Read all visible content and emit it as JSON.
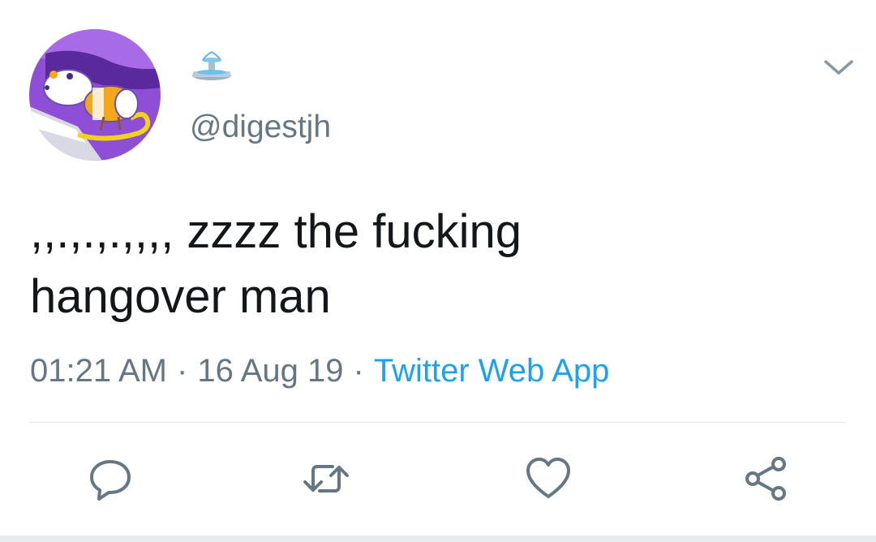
{
  "tweet": {
    "avatar_icon": "avatar-rat-cartoon",
    "display_name_emoji": "fountain-emoji",
    "handle": "@digestjh",
    "text": ",,.,.,.,,,, zzzz the fucking\nhangover man",
    "time": "01:21 AM",
    "date": "16 Aug 19",
    "separator": "·",
    "source": "Twitter Web App"
  },
  "actions": [
    {
      "icon": "reply-icon"
    },
    {
      "icon": "retweet-icon"
    },
    {
      "icon": "like-icon"
    },
    {
      "icon": "share-icon"
    }
  ],
  "colors": {
    "text": "#14171a",
    "secondary": "#657786",
    "link": "#1da1f2",
    "divider": "#e1e8ed"
  }
}
